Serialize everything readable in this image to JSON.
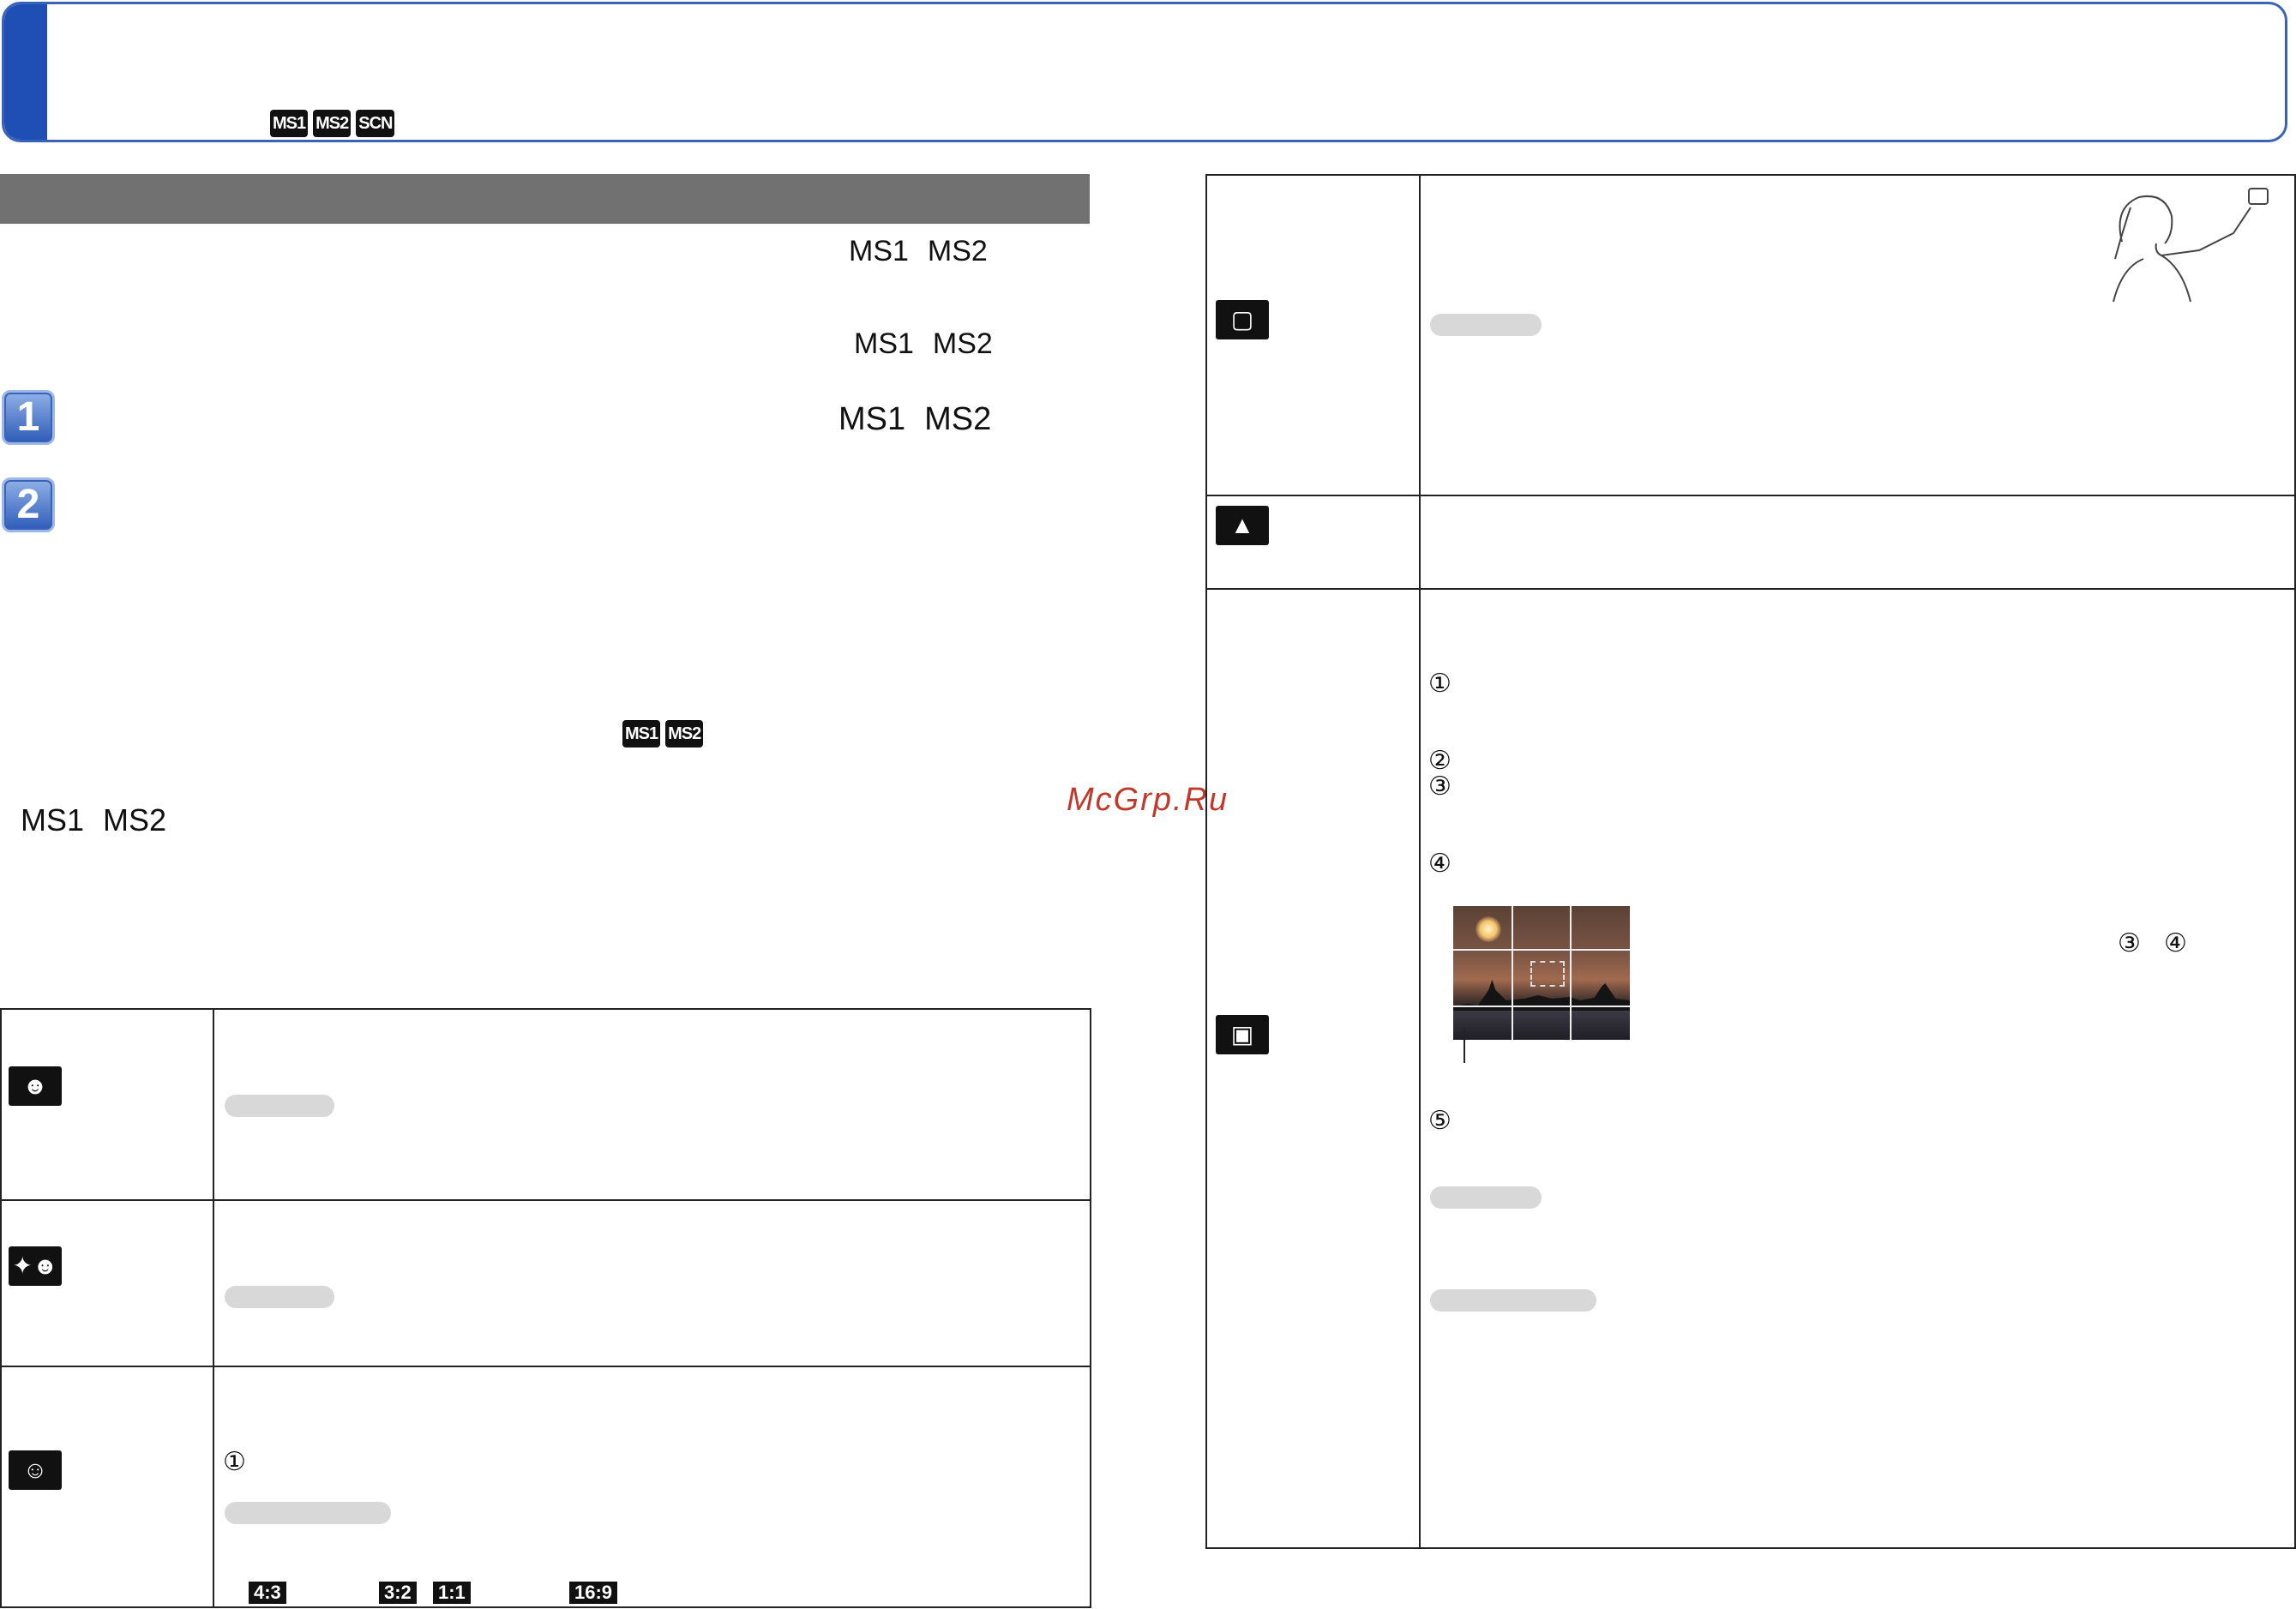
{
  "header": {
    "mode_badges": [
      "MS1",
      "MS2",
      "SCN"
    ]
  },
  "left": {
    "ms_row1": [
      "MS1",
      "MS2"
    ],
    "ms_row2": [
      "MS1",
      "MS2"
    ],
    "step1": {
      "number": "1",
      "ms": [
        "MS1",
        "MS2"
      ]
    },
    "step2": {
      "number": "2"
    },
    "inline_badges": [
      "MS1",
      "MS2"
    ],
    "ms_row3": [
      "MS1",
      "MS2"
    ],
    "table": {
      "rows": [
        {
          "icon": "portrait-icon"
        },
        {
          "icon": "night-portrait-icon"
        },
        {
          "icon": "baby-icon",
          "circ": "①",
          "aspects": [
            "4:3",
            "3:2",
            "1:1",
            "16:9"
          ]
        }
      ]
    }
  },
  "right": {
    "table": {
      "rows": [
        {
          "icon": "self-portrait-icon"
        },
        {
          "icon": "scenery-icon"
        },
        {
          "icon": "panorama-icon",
          "steps": [
            "①",
            "②",
            "③",
            "④",
            "⑤"
          ],
          "ref_steps": [
            "③",
            "④"
          ]
        }
      ]
    }
  },
  "watermark": "McGrp.Ru",
  "colors": {
    "accent_blue": "#1f4fb5",
    "section_gray": "#717171"
  }
}
